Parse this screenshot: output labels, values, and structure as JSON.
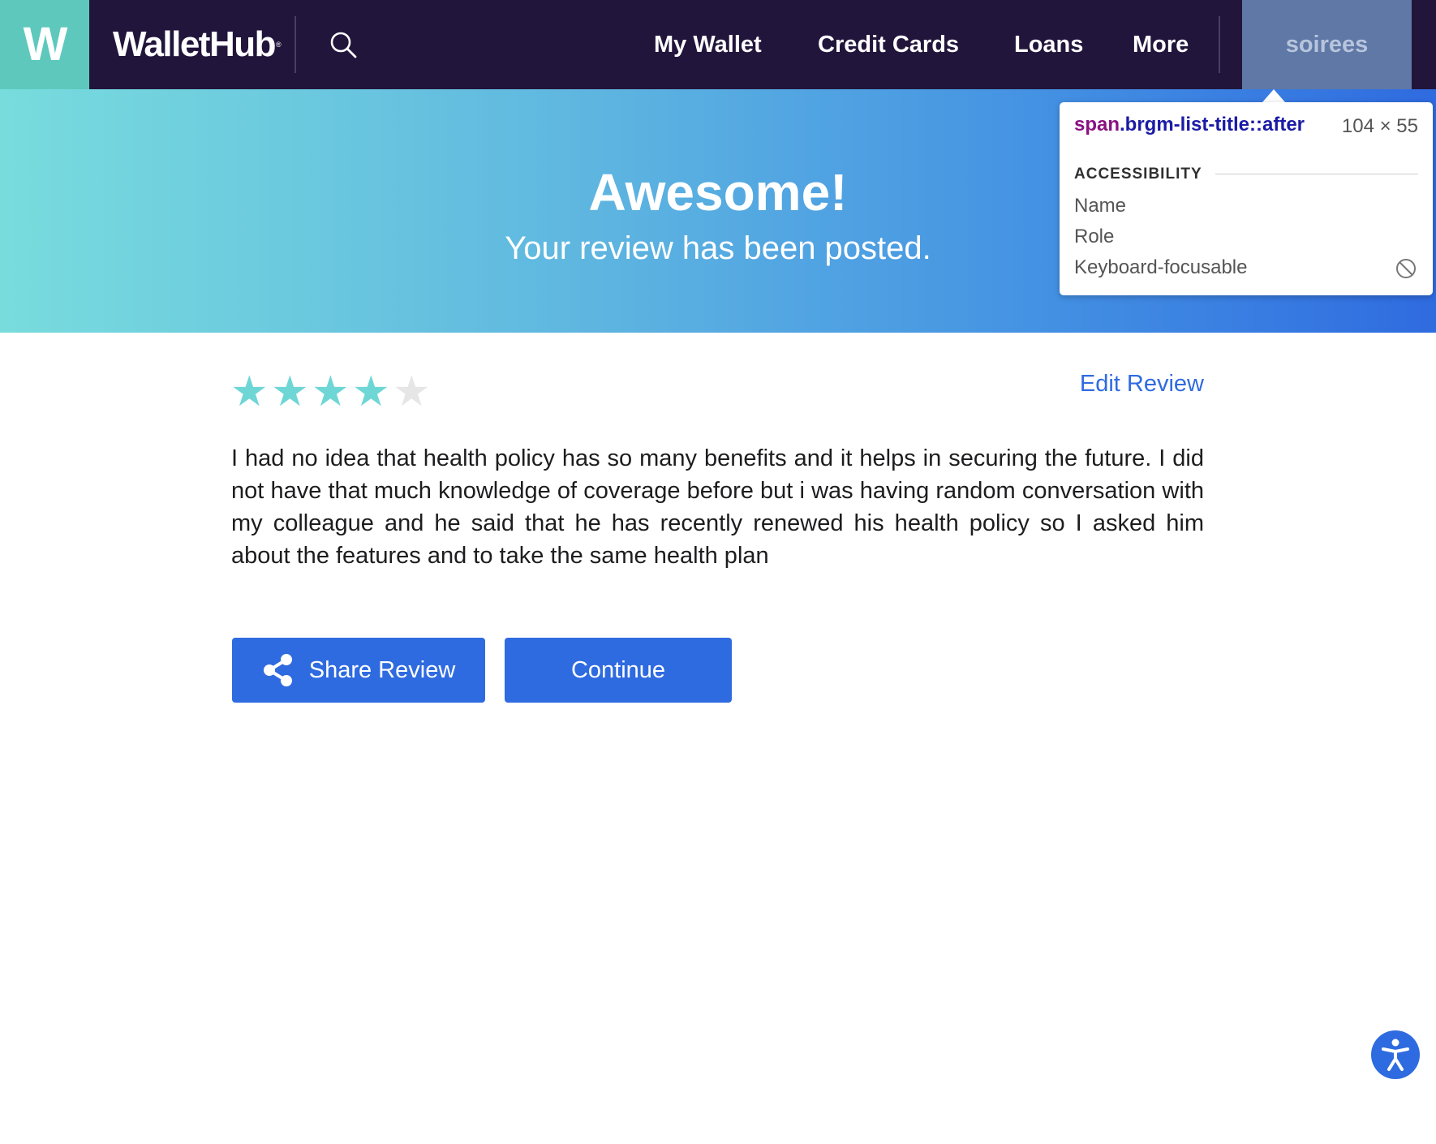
{
  "header": {
    "logo_letter": "W",
    "brand": "WalletHub",
    "brand_mark": "®",
    "search_icon": "search-icon",
    "nav": [
      "My Wallet",
      "Credit Cards",
      "Loans",
      "More"
    ],
    "user": "soirees",
    "colors": {
      "bar": "#22153b",
      "logo": "#5ec8bd",
      "user_box": "#5f78a5"
    }
  },
  "hero": {
    "title": "Awesome!",
    "subtitle": "Your review has been posted.",
    "gradient": [
      "#78dcdd",
      "#2f6be0"
    ]
  },
  "devtools_tooltip": {
    "tag": "span",
    "selector": ".brgm-list-title::after",
    "size": "104 × 55",
    "section": "ACCESSIBILITY",
    "rows": [
      "Name",
      "Role",
      "Keyboard-focusable"
    ],
    "keyboard_icon": "not-allowed-icon"
  },
  "review": {
    "rating": 4,
    "rating_max": 5,
    "star_glyph": "★",
    "edit_label": "Edit Review",
    "text": "I had no idea that health policy has so many benefits and it helps in securing the future. I did not have that much knowledge of coverage before but i was having random conversation with my colleague and he said that he has recently renewed his health policy so I asked him about the features and to take the same health plan"
  },
  "actions": {
    "share_label": "Share Review",
    "share_icon": "share-icon",
    "continue_label": "Continue",
    "accent": "#2f6be0"
  },
  "accessibility_widget": {
    "icon": "accessibility-icon"
  }
}
